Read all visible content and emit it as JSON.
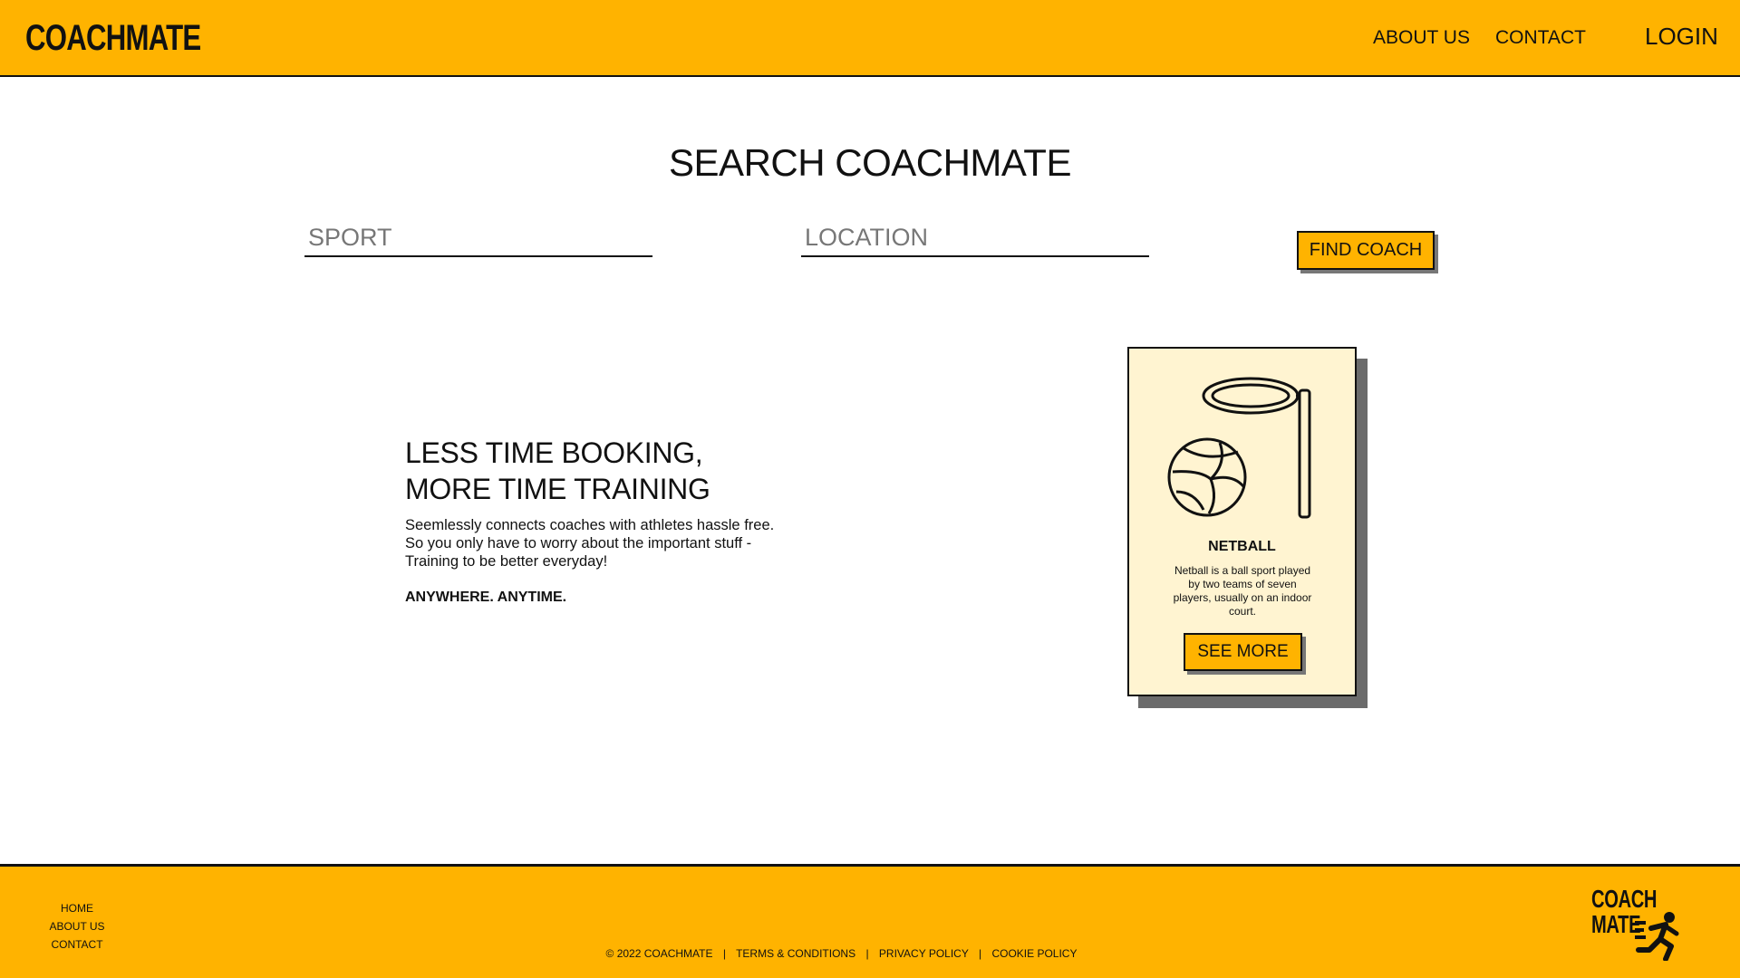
{
  "header": {
    "logo": "COACHMATE",
    "nav": {
      "about": "ABOUT US",
      "contact": "CONTACT",
      "login": "LOGIN"
    }
  },
  "search": {
    "title": "SEARCH COACHMATE",
    "sport_placeholder": "SPORT",
    "location_placeholder": "LOCATION",
    "button": "FIND COACH"
  },
  "hero": {
    "heading_line1": "LESS TIME BOOKING,",
    "heading_line2": "MORE TIME TRAINING",
    "body_line1": "Seemlessly connects coaches with athletes hassle free.",
    "body_line2": "So you only have to worry about the important stuff -",
    "body_line3": "Training to be better everyday!",
    "tagline": "ANYWHERE. ANYTIME."
  },
  "card": {
    "title": "NETBALL",
    "description": "Netball is a ball sport played by two teams of seven players, usually on an indoor court.",
    "button": "SEE MORE",
    "icon": "netball-hoop-icon"
  },
  "footer": {
    "nav": {
      "home": "HOME",
      "about": "ABOUT US",
      "contact": "CONTACT"
    },
    "copyright": "© 2022 COACHMATE",
    "terms": "TERMS & CONDITIONS",
    "privacy": "PRIVACY POLICY",
    "cookie": "COOKIE POLICY",
    "separator": "|",
    "logo_line1": "COACH",
    "logo_line2": "MATE"
  },
  "colors": {
    "brand": "#FFB300",
    "card_bg": "#FFF4D1",
    "shadow": "#6B6B6B",
    "text": "#111111"
  }
}
